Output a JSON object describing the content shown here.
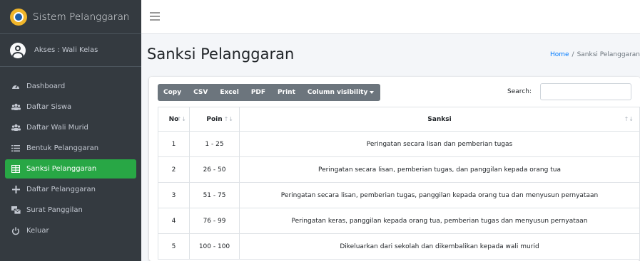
{
  "brand": {
    "title": "Sistem Pelanggaran",
    "logo": "school-logo"
  },
  "user": {
    "label": "Akses : Wali Kelas",
    "icon": "user-circle-icon"
  },
  "sidebar": {
    "items": [
      {
        "label": "Dashboard",
        "icon": "tachometer-icon",
        "active": false
      },
      {
        "label": "Daftar Siswa",
        "icon": "users-icon",
        "active": false
      },
      {
        "label": "Daftar Wali Murid",
        "icon": "users-icon",
        "active": false
      },
      {
        "label": "Bentuk Pelanggaran",
        "icon": "list-icon",
        "active": false
      },
      {
        "label": "Sanksi Pelanggaran",
        "icon": "table-icon",
        "active": true
      },
      {
        "label": "Daftar Pelanggaran",
        "icon": "plus-icon",
        "active": false
      },
      {
        "label": "Surat Panggilan",
        "icon": "mail-bulk-icon",
        "active": false
      },
      {
        "label": "Keluar",
        "icon": "power-off-icon",
        "active": false
      }
    ]
  },
  "header": {
    "title": "Sanksi Pelanggaran",
    "breadcrumb": {
      "home": "Home",
      "separator": "/",
      "current": "Sanksi Pelanggaran"
    }
  },
  "toolbar": {
    "buttons": [
      "Copy",
      "CSV",
      "Excel",
      "PDF",
      "Print",
      "Column visibility"
    ],
    "search_label": "Search:",
    "search_value": ""
  },
  "table": {
    "columns": [
      "No",
      "Poin",
      "Sanksi"
    ],
    "rows": [
      {
        "no": "1",
        "poin": "1 - 25",
        "sanksi": "Peringatan secara lisan dan pemberian tugas"
      },
      {
        "no": "2",
        "poin": "26 - 50",
        "sanksi": "Peringatan secara lisan, pemberian tugas, dan panggilan kepada orang tua"
      },
      {
        "no": "3",
        "poin": "51 - 75",
        "sanksi": "Peringatan secara lisan, pemberian tugas, panggilan kepada orang tua dan menyusun pernyataan"
      },
      {
        "no": "4",
        "poin": "76 - 99",
        "sanksi": "Peringatan keras, panggilan kepada orang tua, pemberian tugas dan menyusun pernyataan"
      },
      {
        "no": "5",
        "poin": "100 - 100",
        "sanksi": "Dikeluarkan dari sekolah dan dikembalikan kepada wali murid"
      }
    ]
  },
  "colors": {
    "sidebar_bg": "#343a40",
    "active": "#28a745",
    "button": "#6c757d",
    "link": "#007bff"
  }
}
